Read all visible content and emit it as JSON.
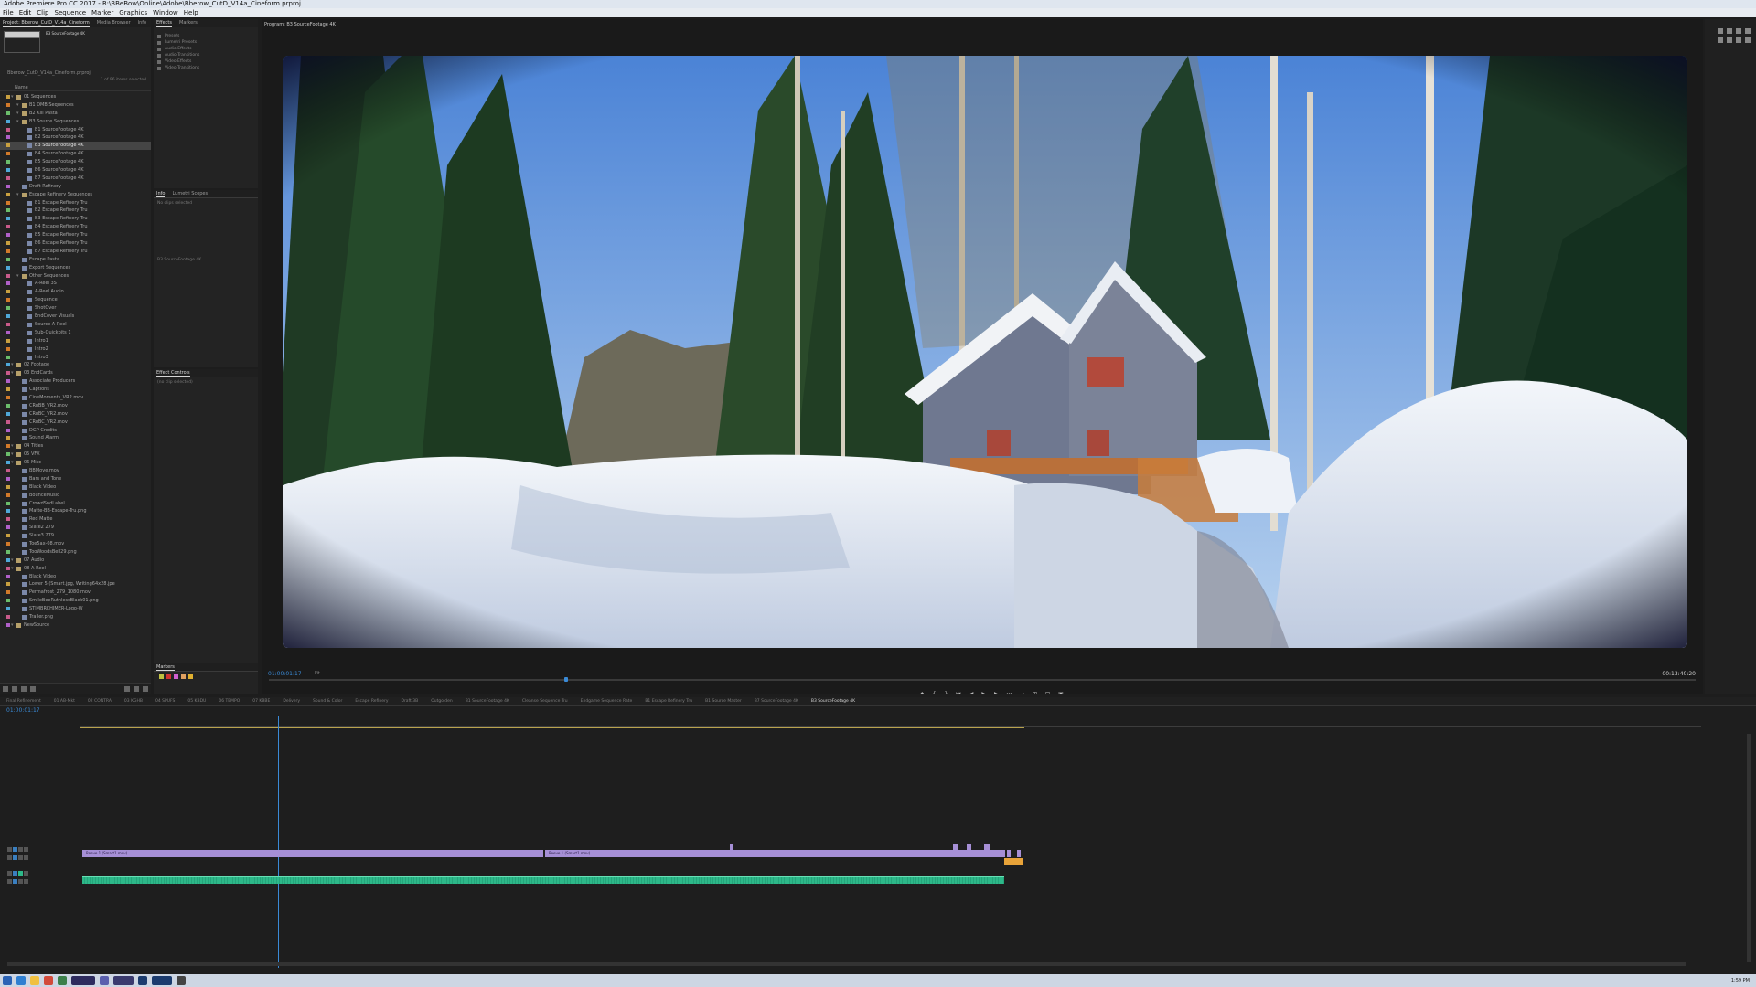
{
  "window": {
    "title": "Adobe Premiere Pro CC 2017 - R:\\BBeBow\\Online\\Adobe\\Bberow_CutD_V14a_Cineform.prproj"
  },
  "menu": [
    "File",
    "Edit",
    "Clip",
    "Sequence",
    "Marker",
    "Graphics",
    "Window",
    "Help"
  ],
  "project_panel": {
    "tabs": [
      "Project: Bberow_CutD_V14a_Cineform",
      "Media Browser",
      "Info"
    ],
    "thumb_title": "B3 SourceFootage 4K",
    "path": "Bberow_CutD_V14a_Cineform.prproj",
    "count": "1 of 96 items selected",
    "name_header": "Name",
    "items": [
      "01 Sequences",
      "B1 DMB Sequences",
      "B2 Kill Pasta",
      "B3 Source Sequences",
      "B1 SourceFootage 4K",
      "B2 SourceFootage 4K",
      "B3 SourceFootage 4K",
      "B4 SourceFootage 4K",
      "B5 SourceFootage 4K",
      "B6 SourceFootage 4K",
      "B7 SourceFootage 4K",
      "Draft Refinery",
      "Escape Refinery Sequences",
      "B1 Escape Refinery Tru",
      "B2 Escape Refinery Tru",
      "B3 Escape Refinery Tru",
      "B4 Escape Refinery Tru",
      "B5 Escape Refinery Tru",
      "B6 Escape Refinery Tru",
      "B7 Escape Refinery Tru",
      "Escape Pasta",
      "Export Sequences",
      "Other Sequences",
      "A-Reel 3S",
      "A-Reel Audio",
      "Sequence",
      "ShotOver",
      "EndCover Visuals",
      "Source A-Reel",
      "Sub-Quickbits 1",
      "Intro1",
      "Intro2",
      "Intro3",
      "02 Footage",
      "03 EndCards",
      "Associate Producers",
      "Captions",
      "CineMoments_VR2.mov",
      "CRuBB_VR2.mov",
      "CRuBC_VR2.mov",
      "CRuBC_VR2.mov",
      "DGP Credits",
      "Sound Alarm",
      "04 Titles",
      "05 VFX",
      "06 Misc",
      "BBMove.mov",
      "Bars and Tone",
      "Black Video",
      "BounceMusic",
      "CrowdSndLabel",
      "Matte-BB-Escape-Tru.png",
      "Red Matte",
      "Slate2 279",
      "Slate3 279",
      "Toe5ax-08.mov",
      "TooWoodsBell29.png",
      "07 Audio",
      "08 A-Reel",
      "Black Video",
      "Lower 5 (Smart.jpg, Writing64x28.jpe",
      "Permafrost_279_1080.mov",
      "SmileBeeRuthlessBlack01.png",
      "STIMBRCHIMER-Logo-W",
      "Trailer.png",
      "NewSource"
    ]
  },
  "effects_panel": {
    "tabs": [
      "Effects",
      "Markers"
    ],
    "items": [
      "Presets",
      "Lumetri Presets",
      "Audio Effects",
      "Audio Transitions",
      "Video Effects",
      "Video Transitions"
    ]
  },
  "effect_controls": {
    "tabs": [
      "Info",
      "Lumetri Scopes"
    ],
    "no_clip": "No clips selected",
    "clip_name": "B3 SourceFootage 4K"
  },
  "audio_mixer": {
    "tabs": [
      "Effect Controls"
    ],
    "no_clip": "(no clip selected)"
  },
  "markers_panel": {
    "label": "Markers",
    "colors": [
      "#c0c040",
      "#d03030",
      "#d060d0",
      "#e0a060",
      "#e0b030"
    ]
  },
  "program_monitor": {
    "tab": "Program: B3 SourceFootage 4K",
    "timecode_current": "01:00:01:17",
    "fit": "Fit",
    "timecode_duration": "00:13:40:20",
    "transport": [
      "◆",
      "{",
      "}",
      "⏮",
      "◀",
      "▶",
      "▶",
      "⏭",
      "→",
      "⊞",
      "⊟",
      "▣"
    ]
  },
  "timeline": {
    "tabs": [
      "Final Refinement",
      "01 AB-Mkt",
      "02 CONTRA",
      "03 KGHB",
      "04 SPUFS",
      "05 KBDU",
      "06 TEMPO",
      "07 KBBE",
      "Delivery",
      "Sound & Color",
      "Escape Refinery",
      "Draft 3B",
      "Outgolden",
      "B1 SourceFootage 4K",
      "Cleanse Sequence Tru",
      "Endgame Sequence Rate",
      "B1 Escape Refinery Tru",
      "B1 Source Master",
      "B7 SourceFootage 4K",
      "B3 SourceFootage 4K"
    ],
    "active_tab": 19,
    "timecode": "01:00:01:17",
    "clip_video_label_1": "Reeve 1 (Smart1.mov)",
    "clip_video_label_2": "Reeve 1 (Smart1.mov)"
  },
  "taskbar": {
    "clock": "1:59 PM"
  }
}
